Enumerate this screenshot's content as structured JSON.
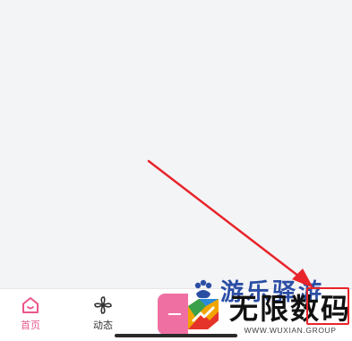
{
  "tabs": [
    {
      "label": "首页",
      "icon": "home-icon",
      "active": true
    },
    {
      "label": "动态",
      "icon": "pinwheel-icon",
      "active": false
    }
  ],
  "center_button": {
    "icon": "plus-icon"
  },
  "watermark": {
    "top_text": "游乐驿游",
    "main_text": "无限数码",
    "sub_text": "WWW.WUXIAN.GROUP"
  },
  "colors": {
    "active_tab": "#e9568c",
    "inactive_tab": "#333333",
    "center_button": "#f06fa3",
    "annotation": "#e8242a",
    "background": "#f3f4f6"
  }
}
